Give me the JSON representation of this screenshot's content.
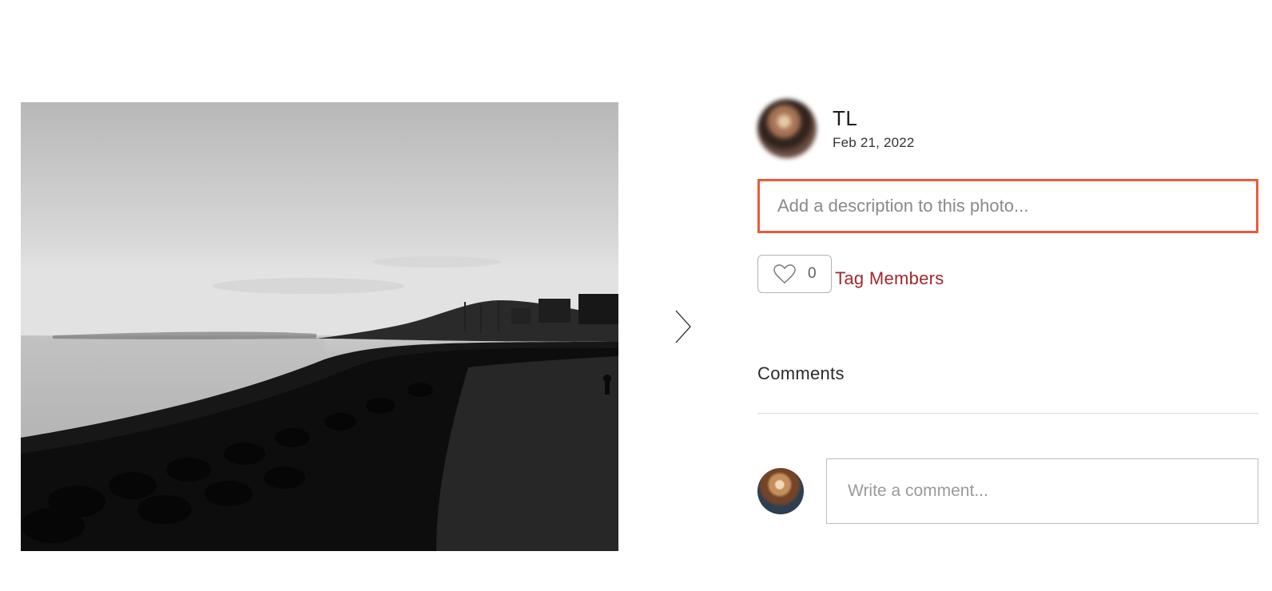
{
  "author": {
    "name": "TL",
    "date": "Feb 21, 2022"
  },
  "description": {
    "placeholder": "Add a description to this photo..."
  },
  "likes": {
    "count": "0"
  },
  "actions": {
    "tag_members_label": "Tag Members"
  },
  "comments": {
    "heading": "Comments",
    "input_placeholder": "Write a comment..."
  }
}
